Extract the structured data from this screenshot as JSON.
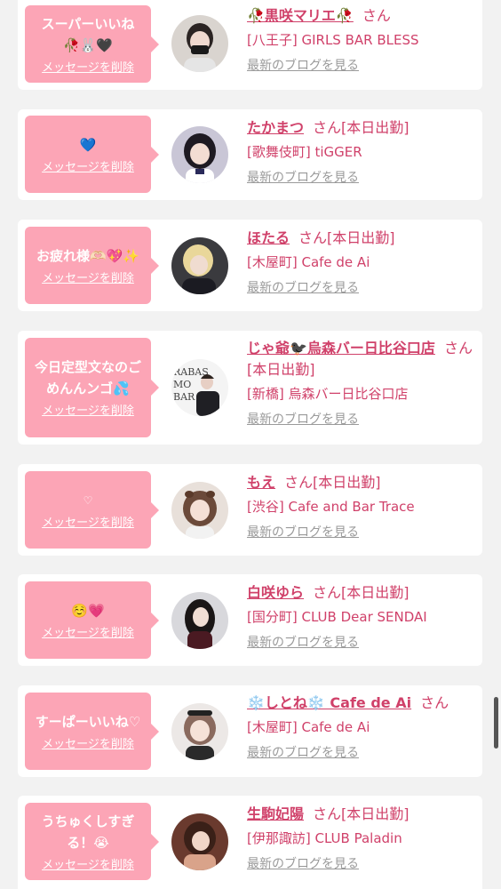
{
  "delete_label": "メッセージを削除",
  "blog_label": "最新のブログを見る",
  "honorific": "さん",
  "colors": {
    "bubble": "#fca5b6",
    "link_pink": "#d0416a",
    "gray": "#9a9a9a"
  },
  "items": [
    {
      "message": "スーパーいいね\n🥀🐰🖤",
      "name": "🥀黒咲マリエ🥀",
      "status": "",
      "shop": "[八王子] GIRLS BAR BLESS",
      "avatar_icon": "avatar-photo-icon"
    },
    {
      "message": "💙",
      "name": "たかまつ",
      "status": "[本日出勤]",
      "shop": "[歌舞伎町] tiGGER",
      "avatar_icon": "avatar-photo-icon"
    },
    {
      "message": "お疲れ様🫶🏻💖✨",
      "name": "ほたる",
      "status": "[本日出勤]",
      "shop": "[木屋町] Cafe de Ai",
      "avatar_icon": "avatar-photo-icon"
    },
    {
      "message": "今日定型文なのご\nめんんンゴ💦",
      "name": "じゃ爺🐦‍⬛烏森バー日比谷口店",
      "status": "[本日出勤]",
      "shop": "[新橋] 烏森バー日比谷口店",
      "avatar_icon": "avatar-logo-icon"
    },
    {
      "message": "♡",
      "name": "もえ",
      "status": "[本日出勤]",
      "shop": "[渋谷] Cafe and Bar Trace",
      "avatar_icon": "avatar-photo-icon"
    },
    {
      "message": "☺️💗",
      "name": "白咲ゆら",
      "status": "[本日出勤]",
      "shop": "[国分町] CLUB Dear SENDAI",
      "avatar_icon": "avatar-photo-icon"
    },
    {
      "message": "すーぱーいいね♡",
      "name": "❄️しとね❄️ Cafe de Ai",
      "status": "",
      "shop": "[木屋町] Cafe de Ai",
      "avatar_icon": "avatar-photo-icon"
    },
    {
      "message": "うちゅくしすぎ\nる！😭",
      "name": "生駒妃陽",
      "status": "[本日出勤]",
      "shop": "[伊那諏訪] CLUB Paladin",
      "avatar_icon": "avatar-photo-icon"
    }
  ]
}
